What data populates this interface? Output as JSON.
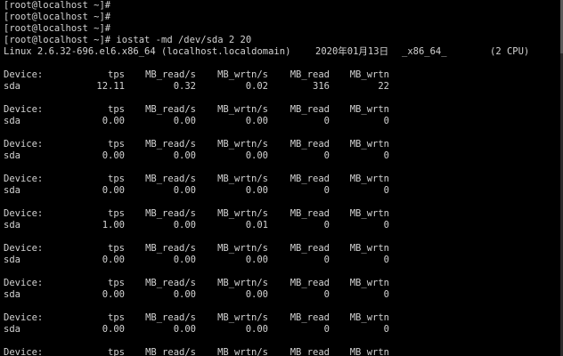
{
  "prompt_lines": [
    "[root@localhost ~]#",
    "[root@localhost ~]#",
    "[root@localhost ~]#",
    "[root@localhost ~]# iostat -md /dev/sda 2 20"
  ],
  "sysinfo": {
    "kernel": "Linux 2.6.32-696.el6.x86_64 (localhost.localdomain)",
    "date": "2020年01月13日",
    "arch": "_x86_64_",
    "cpus": "(2 CPU)"
  },
  "headers": [
    "Device:",
    "tps",
    "MB_read/s",
    "MB_wrtn/s",
    "MB_read",
    "MB_wrtn"
  ],
  "rows": [
    [
      "sda",
      "12.11",
      "0.32",
      "0.02",
      "316",
      "22"
    ],
    [
      "sda",
      "0.00",
      "0.00",
      "0.00",
      "0",
      "0"
    ],
    [
      "sda",
      "0.00",
      "0.00",
      "0.00",
      "0",
      "0"
    ],
    [
      "sda",
      "0.00",
      "0.00",
      "0.00",
      "0",
      "0"
    ],
    [
      "sda",
      "1.00",
      "0.00",
      "0.01",
      "0",
      "0"
    ],
    [
      "sda",
      "0.00",
      "0.00",
      "0.00",
      "0",
      "0"
    ],
    [
      "sda",
      "0.00",
      "0.00",
      "0.00",
      "0",
      "0"
    ],
    [
      "sda",
      "0.00",
      "0.00",
      "0.00",
      "0",
      "0"
    ]
  ],
  "last_header": [
    "Device:",
    "tps",
    "MB_read/s",
    "MB_wrtn/s",
    "MB_read",
    "MB_wrtn"
  ]
}
